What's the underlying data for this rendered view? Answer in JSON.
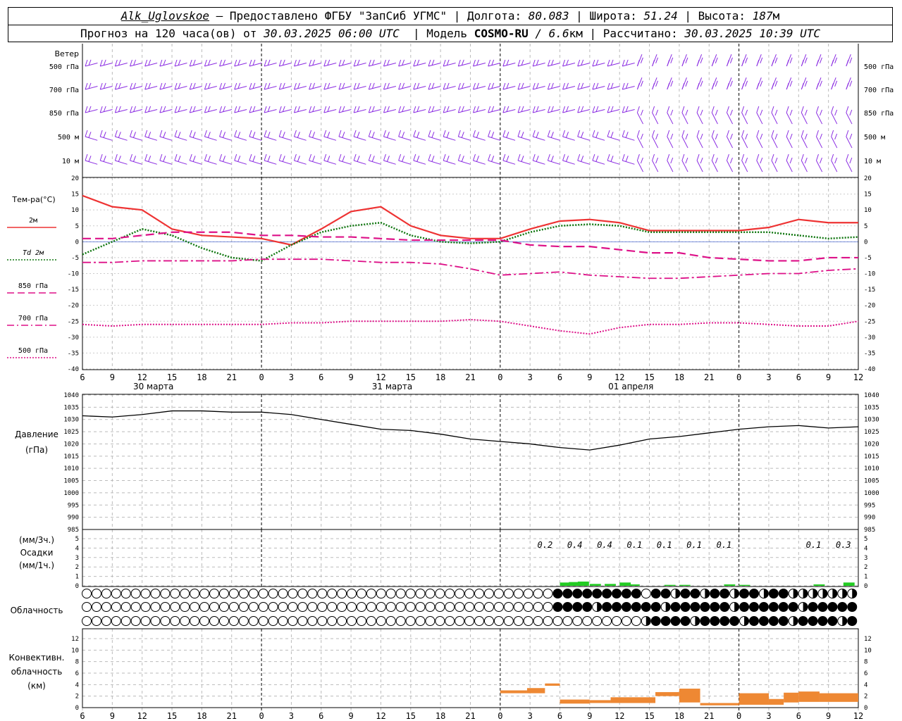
{
  "header": {
    "station": "Alk_Uglovskoe",
    "provider": "– Предоставлено ФГБУ \"ЗапСиб УГМС\"",
    "lon_label": "Долгота:",
    "lon_value": "80.083",
    "lat_label": "Широта:",
    "lat_value": "51.24",
    "alt_label": "Высота:",
    "alt_value": "187",
    "alt_unit": "м",
    "forecast_prefix": "Прогноз на 120 часа(ов) от",
    "forecast_start": "30.03.2025 06:00 UTC",
    "model_label": "Модель",
    "model_name": "COSMO-RU",
    "model_res": "/ 6.6",
    "model_res_unit": "км",
    "calc_label": "Рассчитано:",
    "calc_time": "30.03.2025 10:39 UTC"
  },
  "time_axis": {
    "hours": [
      "6",
      "9",
      "12",
      "15",
      "18",
      "21",
      "0",
      "3",
      "6",
      "9",
      "12",
      "15",
      "18",
      "21",
      "0",
      "3",
      "6",
      "9",
      "12",
      "15",
      "18",
      "21",
      "0",
      "3",
      "6",
      "9",
      "12"
    ],
    "dates": [
      {
        "label": "30 марта",
        "slot": 2
      },
      {
        "label": "31 марта",
        "slot": 10
      },
      {
        "label": "01 апреля",
        "slot": 18
      }
    ]
  },
  "wind_panel": {
    "title": "Ветер",
    "levels": [
      "500 гПа",
      "700 гПа",
      "850 гПа",
      "500 м",
      "10 м"
    ],
    "color": "#8a2be2"
  },
  "temp_panel": {
    "title": "Тем-ра(°С)",
    "legend": [
      {
        "label": "2м",
        "color": "#ee3333",
        "style": "solid"
      },
      {
        "label": "Td 2м",
        "color": "#117711",
        "style": "dotted"
      },
      {
        "label": "850 гПа",
        "color": "#dd1188",
        "style": "dashed"
      },
      {
        "label": "700 гПа",
        "color": "#dd1188",
        "style": "dashdot"
      },
      {
        "label": "500 гПа",
        "color": "#dd1188",
        "style": "dotted"
      }
    ],
    "ticks": [
      "20",
      "15",
      "10",
      "5",
      "0",
      "-5",
      "-10",
      "-15",
      "-20",
      "-25",
      "-30",
      "-35",
      "-40"
    ]
  },
  "pressure_panel": {
    "title1": "Давление",
    "title2": "(гПа)",
    "ticks": [
      "1040",
      "1035",
      "1030",
      "1025",
      "1020",
      "1015",
      "1010",
      "1005",
      "1000",
      "995",
      "990",
      "985"
    ]
  },
  "precip_panel": {
    "title1": "(мм/3ч.)",
    "title2": "Осадки",
    "title3": "(мм/1ч.)",
    "ticks": [
      "5",
      "4",
      "3",
      "2",
      "1",
      "0"
    ],
    "amounts": [
      {
        "text": "0.2",
        "slot": 15.5
      },
      {
        "text": "0.4",
        "slot": 16.5
      },
      {
        "text": "0.4",
        "slot": 17.5
      },
      {
        "text": "0.1",
        "slot": 18.5
      },
      {
        "text": "0.1",
        "slot": 19.5
      },
      {
        "text": "0.1",
        "slot": 20.5
      },
      {
        "text": "0.1",
        "slot": 21.5
      },
      {
        "text": "0.1",
        "slot": 24.5
      },
      {
        "text": "0.3",
        "slot": 25.5
      }
    ],
    "color": "#22cc22"
  },
  "cloud_panel": {
    "title": "Облачность"
  },
  "conv_panel": {
    "title1": "Конвективн.",
    "title2": "облачность",
    "title3": "(км)",
    "ticks": [
      "12",
      "10",
      "8",
      "6",
      "4",
      "2",
      "0"
    ],
    "color": "#ee8833"
  },
  "chart_data": {
    "type": "line",
    "x_hours_from_start": "0..78 step 3 (30.03 06 UTC … 02.04 12 UTC)",
    "series": [
      {
        "name": "2м",
        "x": [
          0,
          1,
          2,
          3,
          4,
          5,
          6,
          7,
          8,
          9,
          10,
          11,
          12,
          13,
          14,
          15,
          16,
          17,
          18,
          19,
          20,
          21,
          22,
          23,
          24,
          25,
          26
        ],
        "values": [
          14.5,
          11,
          10,
          4,
          2,
          1.5,
          1,
          -1,
          4,
          9.5,
          11,
          5,
          2,
          1,
          1,
          4,
          6.5,
          7,
          6,
          3.5,
          3.5,
          3.5,
          3.5,
          4.5,
          7,
          6,
          6
        ]
      },
      {
        "name": "Td 2м",
        "x": [
          0,
          1,
          2,
          3,
          4,
          5,
          6,
          7,
          8,
          9,
          10,
          11,
          12,
          13,
          14,
          15,
          16,
          17,
          18,
          19,
          20,
          21,
          22,
          23,
          24,
          25,
          26
        ],
        "values": [
          -4,
          0,
          4,
          2,
          -2,
          -5,
          -6,
          -1,
          3,
          5,
          6,
          2,
          0,
          -0.5,
          0,
          3,
          5,
          5.5,
          5,
          3,
          3,
          3,
          3,
          3,
          2,
          1,
          1.5
        ]
      },
      {
        "name": "850 гПа",
        "x": [
          0,
          1,
          2,
          3,
          4,
          5,
          6,
          7,
          8,
          9,
          10,
          11,
          12,
          13,
          14,
          15,
          16,
          17,
          18,
          19,
          20,
          21,
          22,
          23,
          24,
          25,
          26
        ],
        "values": [
          1,
          1,
          2,
          3,
          3,
          3,
          2,
          2,
          1.5,
          1.5,
          1,
          0.5,
          0.5,
          0.5,
          0.5,
          -1,
          -1.5,
          -1.5,
          -2.5,
          -3.5,
          -3.5,
          -5,
          -5.5,
          -6,
          -6,
          -5,
          -5
        ]
      },
      {
        "name": "700 гПа",
        "x": [
          0,
          1,
          2,
          3,
          4,
          5,
          6,
          7,
          8,
          9,
          10,
          11,
          12,
          13,
          14,
          15,
          16,
          17,
          18,
          19,
          20,
          21,
          22,
          23,
          24,
          25,
          26
        ],
        "values": [
          -6.5,
          -6.5,
          -6,
          -6,
          -6,
          -6,
          -5.5,
          -5.5,
          -5.5,
          -6,
          -6.5,
          -6.5,
          -7,
          -8.5,
          -10.5,
          -10,
          -9.5,
          -10.5,
          -11,
          -11.5,
          -11.5,
          -11,
          -10.5,
          -10,
          -10,
          -9,
          -8.5
        ]
      },
      {
        "name": "500 гПа",
        "x": [
          0,
          1,
          2,
          3,
          4,
          5,
          6,
          7,
          8,
          9,
          10,
          11,
          12,
          13,
          14,
          15,
          16,
          17,
          18,
          19,
          20,
          21,
          22,
          23,
          24,
          25,
          26
        ],
        "values": [
          -26,
          -26.5,
          -26,
          -26,
          -26,
          -26,
          -26,
          -25.5,
          -25.5,
          -25,
          -25,
          -25,
          -25,
          -24.5,
          -25,
          -26.5,
          -28,
          -29,
          -27,
          -26,
          -26,
          -25.5,
          -25.5,
          -26,
          -26.5,
          -26.5,
          -25
        ]
      },
      {
        "name": "Давление",
        "x": [
          0,
          1,
          2,
          3,
          4,
          5,
          6,
          7,
          8,
          9,
          10,
          11,
          12,
          13,
          14,
          15,
          16,
          17,
          18,
          19,
          20,
          21,
          22,
          23,
          24,
          25,
          26
        ],
        "values": [
          1031.5,
          1031,
          1032,
          1033.5,
          1033.5,
          1033,
          1033,
          1032,
          1030,
          1028,
          1026,
          1025.5,
          1024,
          1022,
          1021,
          1020,
          1018.5,
          1017.5,
          1019.5,
          1022,
          1023,
          1024.5,
          1026,
          1027,
          1027.5,
          1026.5,
          1027
        ]
      }
    ],
    "ylim_temp": [
      -40,
      20
    ],
    "ylim_pressure": [
      985,
      1040
    ],
    "grid": true
  }
}
